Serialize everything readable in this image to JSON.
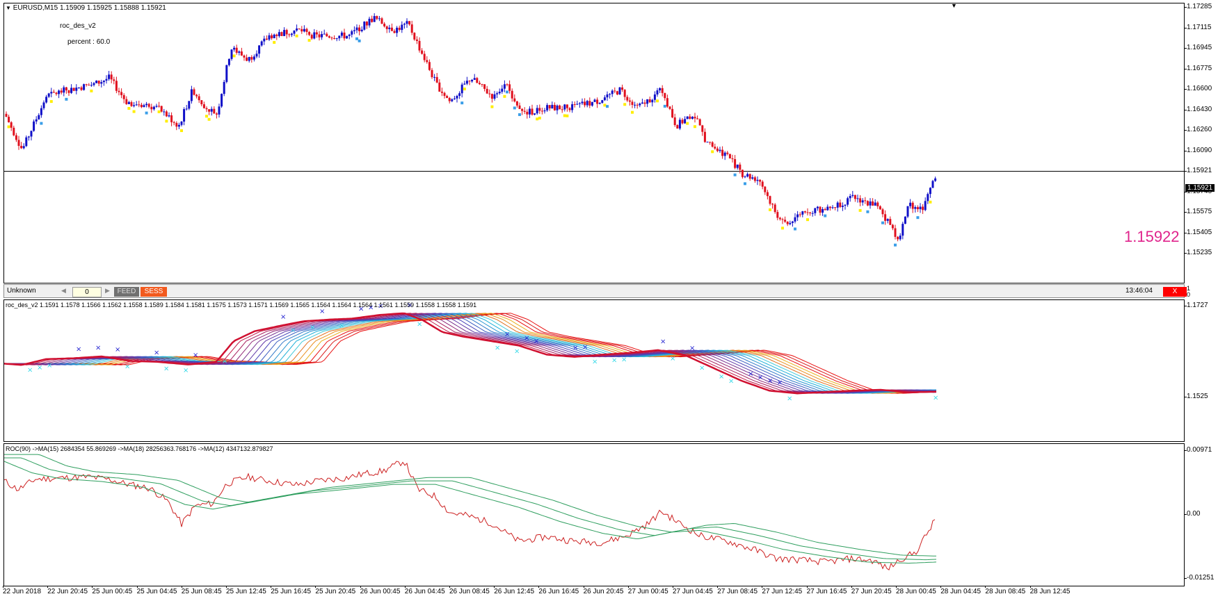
{
  "main": {
    "symbol_info": "EURUSD,M15  1.15909 1.15925 1.15888 1.15921",
    "indicator_name": "roc_des_v2",
    "percent_label": "percent : 60.0",
    "big_price": "1.15922",
    "big_price_color": "#e0248c",
    "current_price_tag": "1.15921",
    "y_ticks": [
      "1.17285",
      "1.17115",
      "1.16945",
      "1.16775",
      "1.16600",
      "1.16430",
      "1.16260",
      "1.16090",
      "1.15921",
      "1.15745",
      "1.15575",
      "1.15405",
      "1.15235"
    ]
  },
  "status_bar": {
    "profile": "Unknown",
    "counter_value": "0",
    "feed_label": "FEED",
    "sess_label": "SESS",
    "time": "13:46:04",
    "close_label": "X",
    "axis_ticks": [
      "1",
      "0"
    ]
  },
  "ind1": {
    "header": "roc_des_v2 1.1591 1.1578 1.1566 1.1562 1.1558 1.1589 1.1584 1.1581 1.1575 1.1573 1.1571 1.1569 1.1565 1.1564 1.1564 1.1564 1.1561 1.1559 1.1558 1.1558 1.1591",
    "y_ticks": [
      "1.1727",
      "1.1525"
    ]
  },
  "ind2": {
    "header": "ROC(90)  ->MA(15) 2684354 55.869269  ->MA(18) 28256363.768176  ->MA(12) 4347132.879827",
    "y_ticks": [
      "0.00971",
      "0.00",
      "-0.01251"
    ]
  },
  "x_axis": [
    "22 Jun 2018",
    "22 Jun 20:45",
    "25 Jun 00:45",
    "25 Jun 04:45",
    "25 Jun 08:45",
    "25 Jun 12:45",
    "25 Jun 16:45",
    "25 Jun 20:45",
    "26 Jun 00:45",
    "26 Jun 04:45",
    "26 Jun 08:45",
    "26 Jun 12:45",
    "26 Jun 16:45",
    "26 Jun 20:45",
    "27 Jun 00:45",
    "27 Jun 04:45",
    "27 Jun 08:45",
    "27 Jun 12:45",
    "27 Jun 16:45",
    "27 Jun 20:45",
    "28 Jun 00:45",
    "28 Jun 04:45",
    "28 Jun 08:45",
    "28 Jun 12:45"
  ],
  "colors": {
    "bull_candle": "#1010c8",
    "bear_candle": "#e0101e",
    "signal_yellow": "#ffee00",
    "signal_lightblue": "#3a9ee8",
    "ribbon_red": "#e81010",
    "roc_line": "#cc2020",
    "ma_lines": "#2e9e5e"
  },
  "chart_data": [
    {
      "type": "candlestick",
      "title": "EURUSD,M15",
      "ylim": [
        1.15235,
        1.17285
      ],
      "current_price": 1.15921,
      "close_path": [
        [
          0,
          1.164
        ],
        [
          25,
          1.161
        ],
        [
          60,
          1.1655
        ],
        [
          90,
          1.166
        ],
        [
          130,
          1.1665
        ],
        [
          150,
          1.167
        ],
        [
          175,
          1.165
        ],
        [
          220,
          1.1645
        ],
        [
          250,
          1.163
        ],
        [
          270,
          1.166
        ],
        [
          290,
          1.1645
        ],
        [
          305,
          1.164
        ],
        [
          325,
          1.1695
        ],
        [
          350,
          1.1685
        ],
        [
          380,
          1.1705
        ],
        [
          420,
          1.171
        ],
        [
          445,
          1.1705
        ],
        [
          495,
          1.1705
        ],
        [
          530,
          1.172
        ],
        [
          560,
          1.171
        ],
        [
          580,
          1.1715
        ],
        [
          600,
          1.169
        ],
        [
          620,
          1.1665
        ],
        [
          640,
          1.165
        ],
        [
          670,
          1.167
        ],
        [
          700,
          1.1655
        ],
        [
          720,
          1.1665
        ],
        [
          745,
          1.164
        ],
        [
          775,
          1.1645
        ],
        [
          810,
          1.1645
        ],
        [
          850,
          1.165
        ],
        [
          885,
          1.166
        ],
        [
          910,
          1.1645
        ],
        [
          945,
          1.166
        ],
        [
          965,
          1.163
        ],
        [
          990,
          1.164
        ],
        [
          1010,
          1.1615
        ],
        [
          1040,
          1.1605
        ],
        [
          1060,
          1.159
        ],
        [
          1085,
          1.1585
        ],
        [
          1110,
          1.1555
        ],
        [
          1125,
          1.1548
        ],
        [
          1150,
          1.156
        ],
        [
          1180,
          1.156
        ],
        [
          1220,
          1.157
        ],
        [
          1250,
          1.1565
        ],
        [
          1270,
          1.155
        ],
        [
          1285,
          1.1535
        ],
        [
          1300,
          1.1565
        ],
        [
          1320,
          1.156
        ],
        [
          1340,
          1.1592
        ]
      ]
    },
    {
      "type": "line",
      "title": "roc_des_v2",
      "ylim": [
        1.1525,
        1.1727
      ],
      "series": [
        {
          "values": [
            [
              0,
              1.16
            ],
            [
              25,
              1.1597
            ],
            [
              60,
              1.161
            ],
            [
              100,
              1.1612
            ],
            [
              140,
              1.1616
            ],
            [
              180,
              1.1606
            ],
            [
              220,
              1.1604
            ],
            [
              265,
              1.1598
            ],
            [
              305,
              1.1604
            ],
            [
              330,
              1.165
            ],
            [
              360,
              1.1672
            ],
            [
              400,
              1.1685
            ],
            [
              430,
              1.1694
            ],
            [
              470,
              1.1698
            ],
            [
              500,
              1.17
            ],
            [
              540,
              1.1708
            ],
            [
              575,
              1.1712
            ],
            [
              600,
              1.1698
            ],
            [
              630,
              1.167
            ],
            [
              660,
              1.166
            ],
            [
              700,
              1.165
            ],
            [
              740,
              1.164
            ],
            [
              780,
              1.162
            ],
            [
              820,
              1.1615
            ],
            [
              860,
              1.162
            ],
            [
              900,
              1.1624
            ],
            [
              940,
              1.163
            ],
            [
              980,
              1.1618
            ],
            [
              1020,
              1.159
            ],
            [
              1060,
              1.1562
            ],
            [
              1100,
              1.154
            ],
            [
              1140,
              1.1534
            ],
            [
              1180,
              1.1537
            ],
            [
              1220,
              1.154
            ],
            [
              1260,
              1.1542
            ],
            [
              1300,
              1.1536
            ],
            [
              1340,
              1.1538
            ]
          ]
        }
      ]
    },
    {
      "type": "line",
      "title": "ROC(90)",
      "ylim": [
        -0.01251,
        0.00971
      ],
      "series": [
        {
          "values": [
            [
              0,
              0.0045
            ],
            [
              20,
              0.003
            ],
            [
              45,
              0.0048
            ],
            [
              80,
              0.005
            ],
            [
              120,
              0.0052
            ],
            [
              150,
              0.0048
            ],
            [
              175,
              0.004
            ],
            [
              210,
              0.0032
            ],
            [
              235,
              0.001
            ],
            [
              255,
              -0.003
            ],
            [
              275,
              0.0002
            ],
            [
              300,
              0.0006
            ],
            [
              320,
              0.004
            ],
            [
              350,
              0.0052
            ],
            [
              380,
              0.0045
            ],
            [
              420,
              0.0038
            ],
            [
              450,
              0.0045
            ],
            [
              490,
              0.005
            ],
            [
              520,
              0.0058
            ],
            [
              545,
              0.0062
            ],
            [
              575,
              0.008
            ],
            [
              595,
              0.003
            ],
            [
              620,
              0.0018
            ],
            [
              640,
              -0.001
            ],
            [
              665,
              -0.0015
            ],
            [
              700,
              -0.0028
            ],
            [
              740,
              -0.006
            ],
            [
              780,
              -0.0052
            ],
            [
              820,
              -0.006
            ],
            [
              860,
              -0.0062
            ],
            [
              895,
              -0.005
            ],
            [
              925,
              -0.003
            ],
            [
              945,
              -0.0008
            ],
            [
              970,
              -0.0028
            ],
            [
              1000,
              -0.005
            ],
            [
              1040,
              -0.006
            ],
            [
              1080,
              -0.0075
            ],
            [
              1110,
              -0.009
            ],
            [
              1140,
              -0.0092
            ],
            [
              1180,
              -0.0096
            ],
            [
              1220,
              -0.009
            ],
            [
              1250,
              -0.0094
            ],
            [
              1270,
              -0.0108
            ],
            [
              1290,
              -0.009
            ],
            [
              1310,
              -0.008
            ],
            [
              1325,
              -0.005
            ],
            [
              1340,
              -0.002
            ]
          ]
        },
        {
          "values": [
            [
              0,
              0.0085
            ],
            [
              40,
              0.0065
            ],
            [
              80,
              0.0055
            ],
            [
              140,
              0.005
            ],
            [
              200,
              0.004
            ],
            [
              260,
              0.001
            ],
            [
              300,
              0.0002
            ],
            [
              360,
              0.0015
            ],
            [
              420,
              0.0028
            ],
            [
              480,
              0.0035
            ],
            [
              560,
              0.0045
            ],
            [
              620,
              0.0045
            ],
            [
              680,
              0.0025
            ],
            [
              740,
              0.0005
            ],
            [
              800,
              -0.002
            ],
            [
              860,
              -0.004
            ],
            [
              910,
              -0.005
            ],
            [
              960,
              -0.0038
            ],
            [
              1000,
              -0.0035
            ],
            [
              1060,
              -0.005
            ],
            [
              1120,
              -0.0068
            ],
            [
              1180,
              -0.008
            ],
            [
              1240,
              -0.009
            ],
            [
              1300,
              -0.0092
            ],
            [
              1340,
              -0.009
            ]
          ]
        }
      ]
    }
  ]
}
